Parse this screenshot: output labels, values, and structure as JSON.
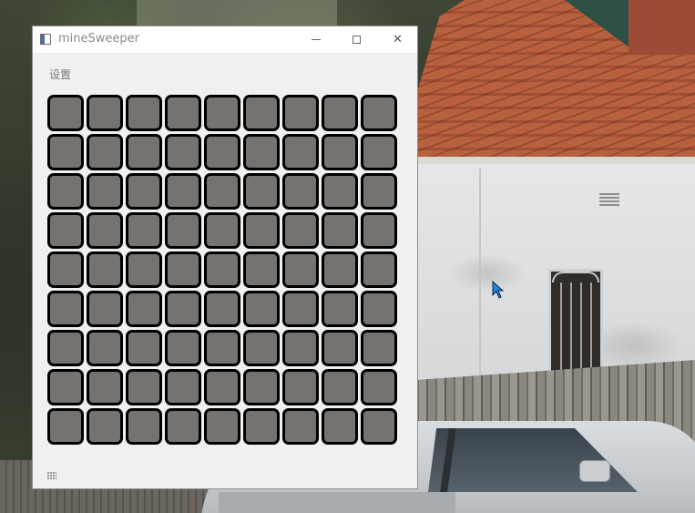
{
  "window": {
    "title": "mineSweeper",
    "icon": "app-window-icon",
    "controls": [
      "minimize-icon",
      "maximize-icon",
      "close-icon"
    ],
    "close_glyph": "✕"
  },
  "menu": {
    "items": [
      {
        "label": "设置"
      }
    ]
  },
  "board": {
    "rows": 9,
    "cols": 9,
    "cell_state": "unrevealed",
    "cell_color": "#757270",
    "cell_border_color": "#000000"
  },
  "statusbar": {
    "grip": "size-grip-icon"
  },
  "desktop": {
    "wallpaper": "photo of a white house with red tiled roof, fence and a silver car",
    "cursor": "mouse-pointer-icon"
  }
}
